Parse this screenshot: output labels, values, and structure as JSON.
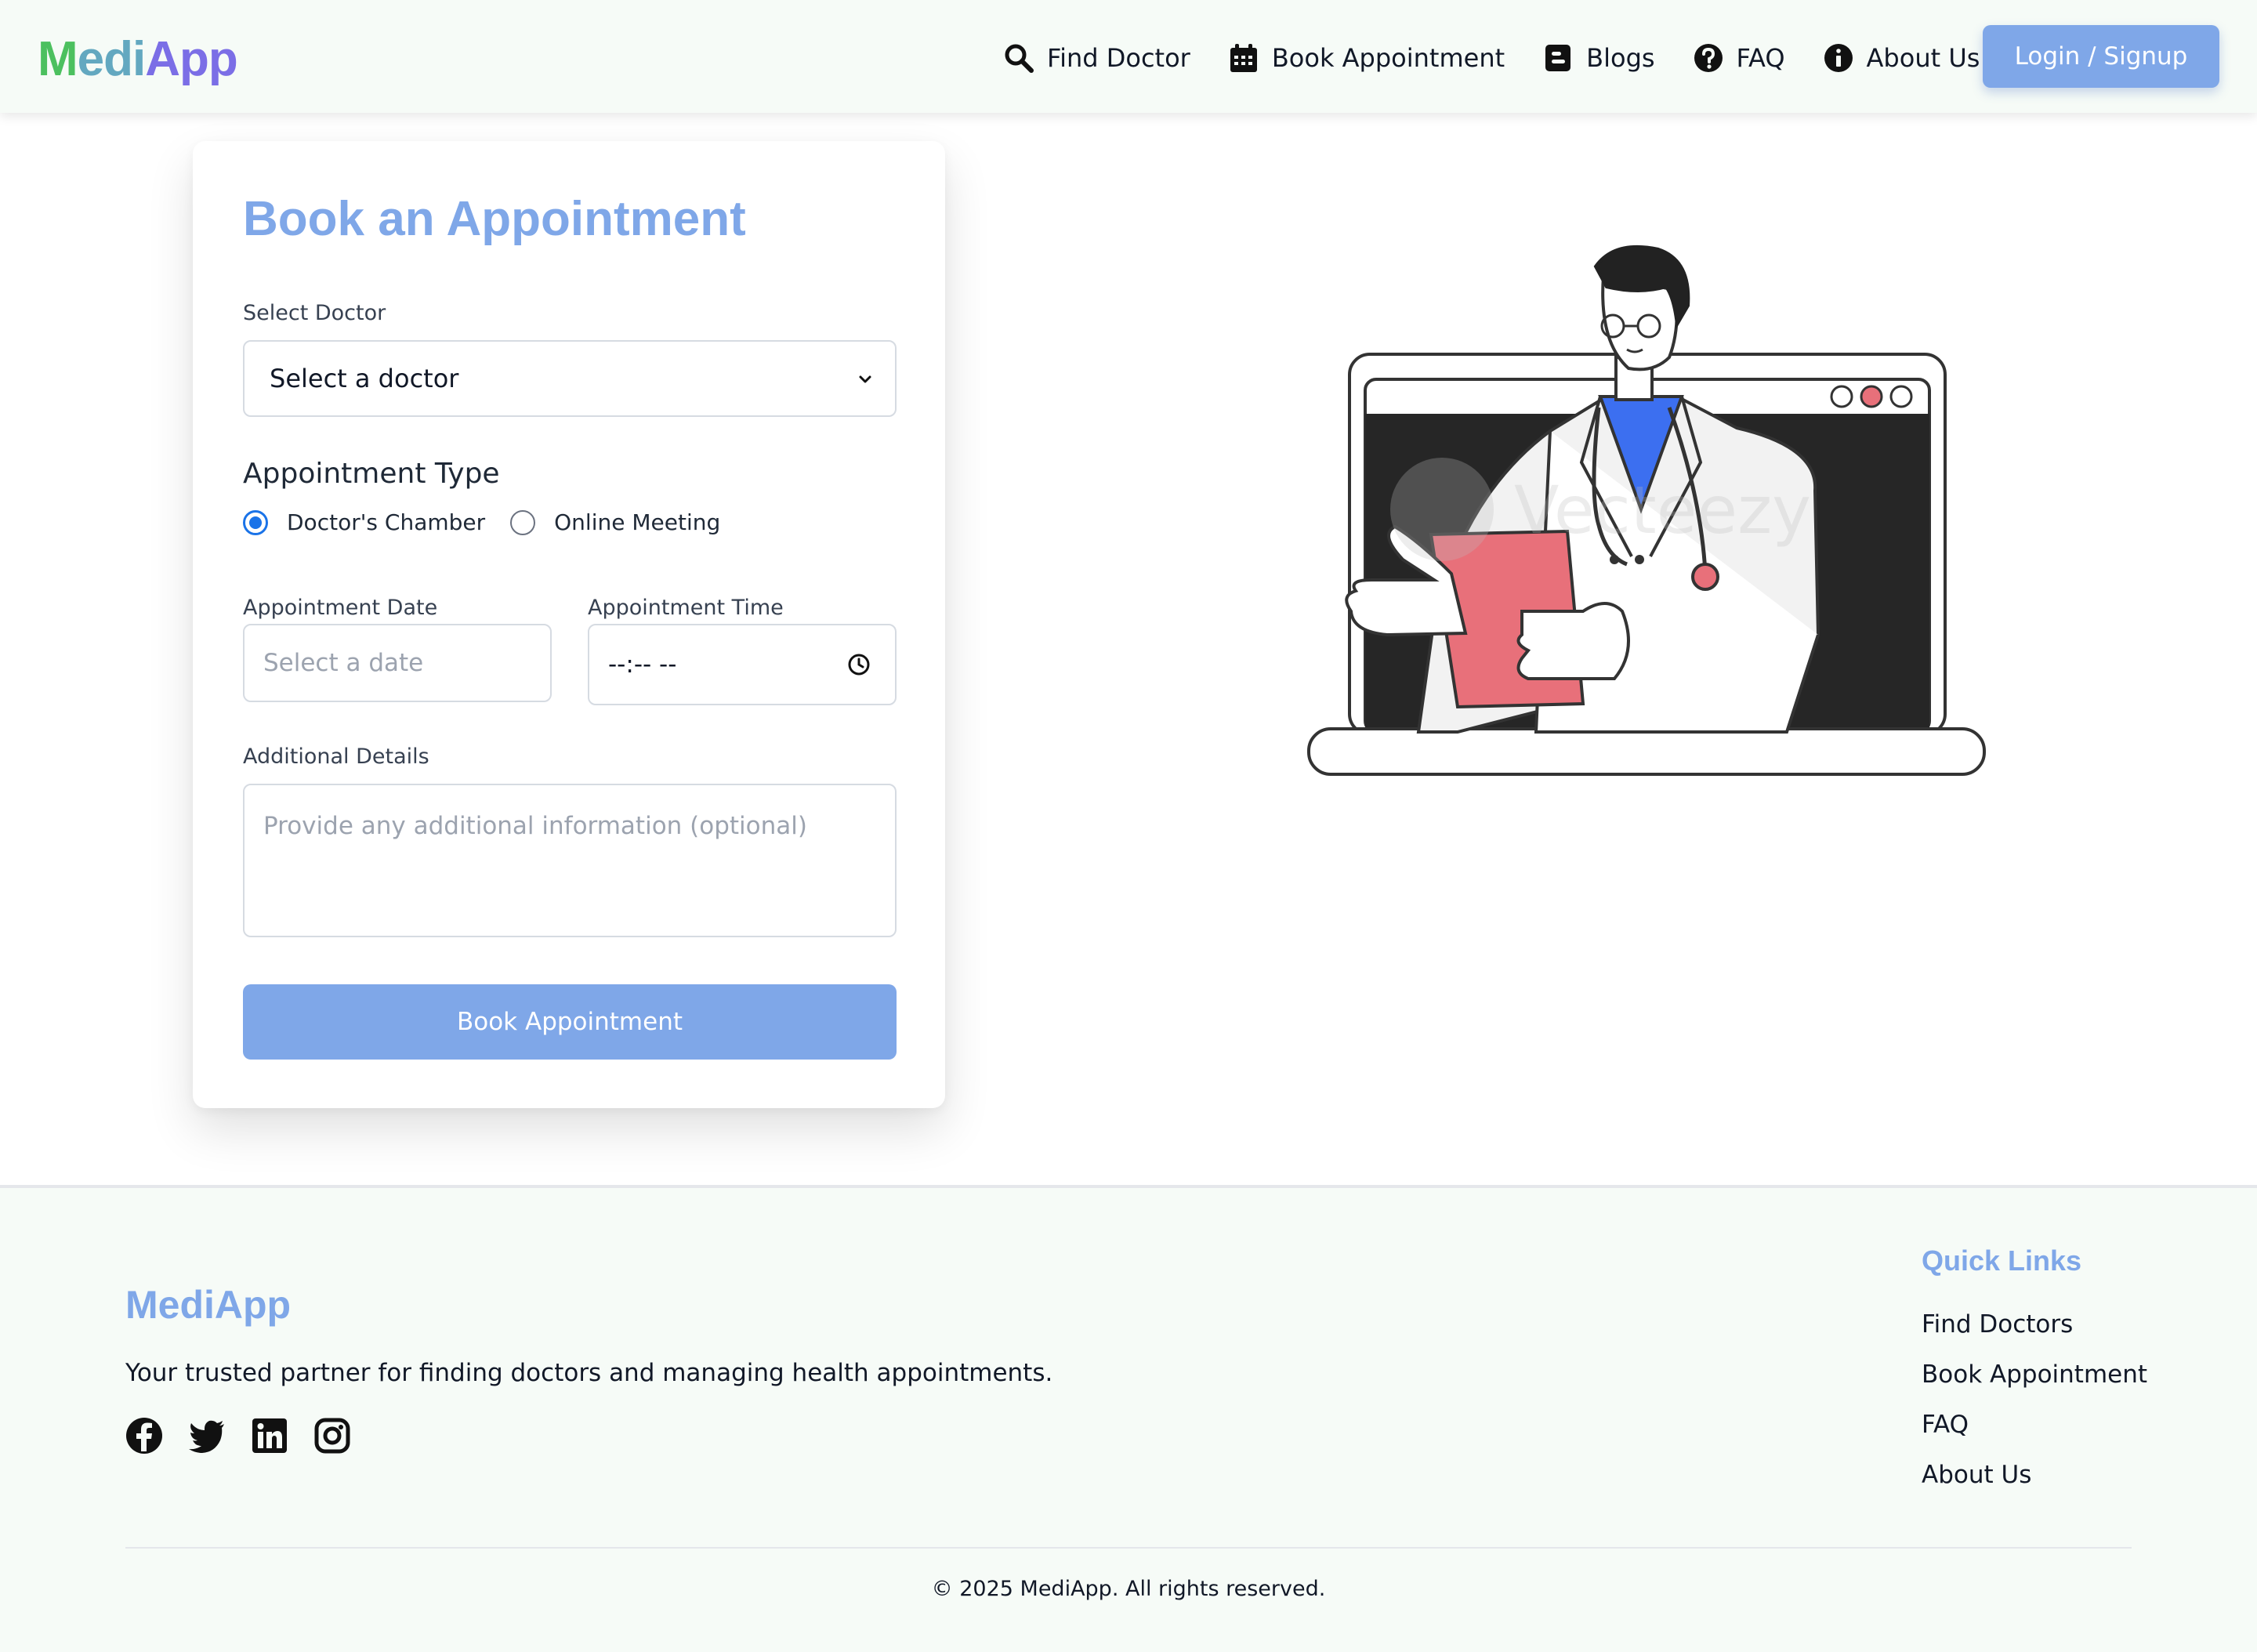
{
  "navbar": {
    "logo_parts": [
      "M",
      "edi",
      "App"
    ],
    "items": [
      {
        "label": "Find Doctor",
        "icon": "search-icon"
      },
      {
        "label": "Book Appointment",
        "icon": "calendar-icon"
      },
      {
        "label": "Blogs",
        "icon": "blogger-icon"
      },
      {
        "label": "FAQ",
        "icon": "question-circle-icon"
      },
      {
        "label": "About Us",
        "icon": "info-circle-icon"
      }
    ],
    "login_label": "Login / Signup"
  },
  "form": {
    "title": "Book an Appointment",
    "doctor_label": "Select Doctor",
    "doctor_value": "Select a doctor",
    "type_title": "Appointment Type",
    "type_options": [
      {
        "label": "Doctor's Chamber",
        "checked": true
      },
      {
        "label": "Online Meeting",
        "checked": false
      }
    ],
    "date_label": "Appointment Date",
    "date_placeholder": "Select a date",
    "time_label": "Appointment Time",
    "time_value": "--:-- --",
    "details_label": "Additional Details",
    "details_placeholder": "Provide any additional information (optional)",
    "submit_label": "Book Appointment"
  },
  "footer": {
    "brand": "MediApp",
    "tagline": "Your trusted partner for finding doctors and managing health appointments.",
    "socials": [
      "facebook-icon",
      "twitter-icon",
      "linkedin-icon",
      "instagram-icon"
    ],
    "quick_links_title": "Quick Links",
    "quick_links": [
      "Find Doctors",
      "Book Appointment",
      "FAQ",
      "About Us"
    ],
    "copyright": "© 2025 MediApp. All rights reserved."
  },
  "colors": {
    "accent": "#7fa7e8",
    "logo_green": "#4cc05f",
    "logo_purple": "#7b6ee6",
    "radio_blue": "#1a73e8",
    "nav_bg": "#f6fbf7"
  }
}
